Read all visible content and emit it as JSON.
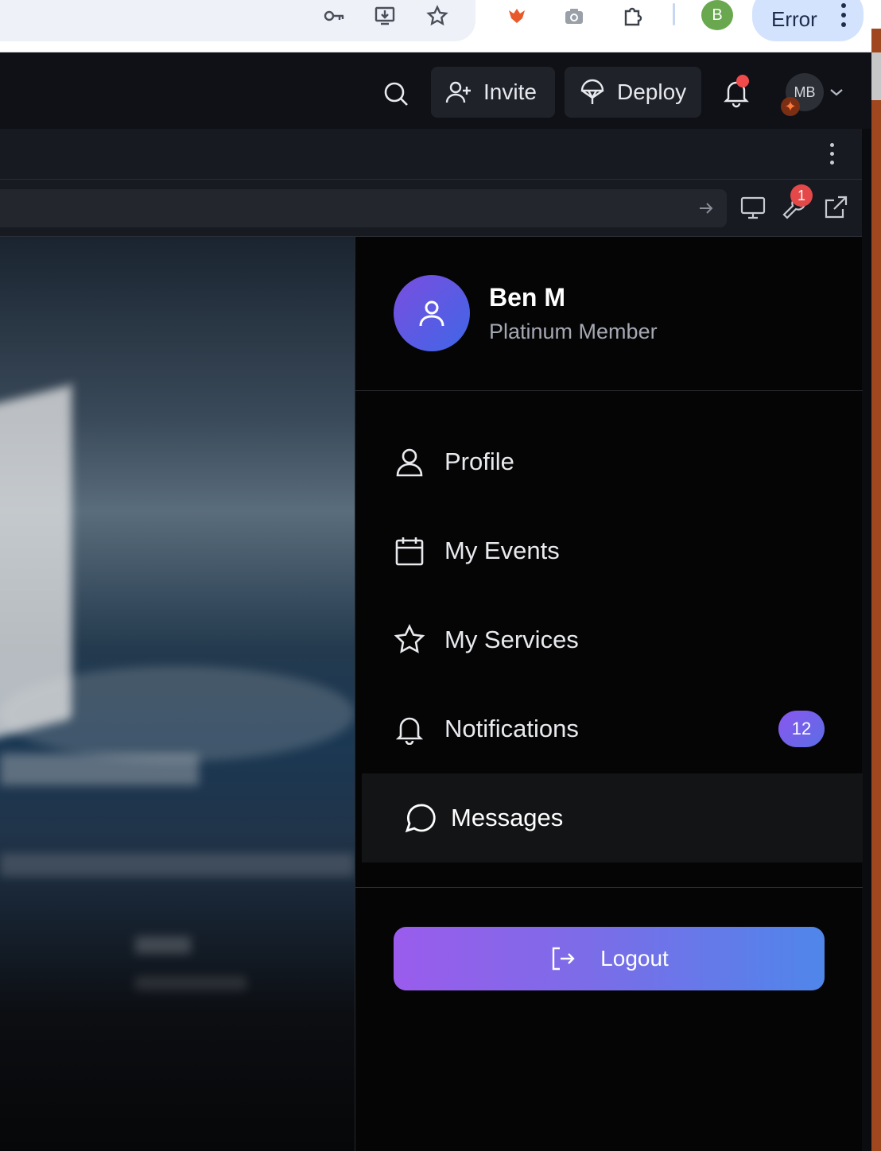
{
  "browser": {
    "profile_initial": "B",
    "error_label": "Error",
    "icons": [
      "key-icon",
      "install-icon",
      "star-icon",
      "fox-extension-icon",
      "camera-icon",
      "extensions-puzzle-icon"
    ]
  },
  "header": {
    "invite_label": "Invite",
    "deploy_label": "Deploy",
    "avatar_initials": "MB"
  },
  "toolbar": {
    "tools_badge": "1"
  },
  "drawer": {
    "user_name": "Ben M",
    "user_tier": "Platinum Member",
    "menu": [
      {
        "label": "Profile",
        "icon": "user-icon"
      },
      {
        "label": "My Events",
        "icon": "calendar-icon"
      },
      {
        "label": "My Services",
        "icon": "star-icon"
      },
      {
        "label": "Notifications",
        "icon": "bell-icon",
        "count": "12"
      },
      {
        "label": "Messages",
        "icon": "message-icon",
        "active": true
      }
    ],
    "logout_label": "Logout"
  },
  "colors": {
    "accent_start": "#9a5cec",
    "accent_end": "#4f86ea",
    "badge_red": "#e54848"
  }
}
